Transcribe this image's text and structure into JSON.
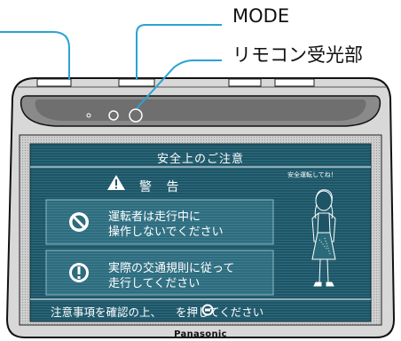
{
  "callouts": {
    "mode": "MODE",
    "remote_sensor": "リモコン受光部"
  },
  "screen": {
    "title": "安全上のご注意",
    "warning_heading": "警 告",
    "speech_bubble": "安全運転してね！",
    "box1": {
      "line1": "運転者は走行中に",
      "line2": "操作しないでください"
    },
    "box2": {
      "line1": "実際の交通規則に従って",
      "line2": "走行してください"
    },
    "footer": "注意事項を確認の上、",
    "footer_icon": "mode-button-icon",
    "footer_end": "を押してください"
  },
  "device": {
    "brand": "Panasonic"
  },
  "colors": {
    "screen_bg": "#1e5566",
    "screen_line": "#2c6a7c",
    "callout_line": "#2aa3d4"
  }
}
